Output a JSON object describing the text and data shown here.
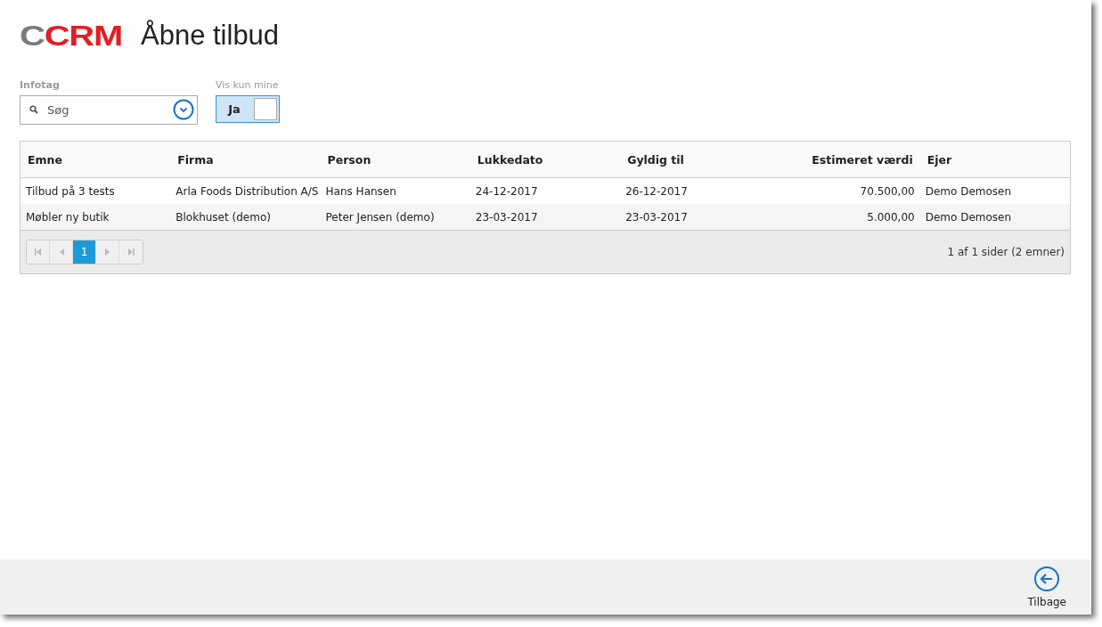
{
  "header": {
    "logo_prefix": "C",
    "logo_main": "CRM",
    "title": "Åbne tilbud"
  },
  "filters": {
    "infotag": {
      "label": "Infotag",
      "placeholder": "Søg"
    },
    "mine": {
      "label": "Vis kun mine",
      "value": "Ja",
      "on": true
    }
  },
  "table": {
    "columns": [
      {
        "label": "Emne",
        "numeric": false
      },
      {
        "label": "Firma",
        "numeric": false
      },
      {
        "label": "Person",
        "numeric": false
      },
      {
        "label": "Lukkedato",
        "numeric": false
      },
      {
        "label": "Gyldig til",
        "numeric": false
      },
      {
        "label": "Estimeret værdi",
        "numeric": true
      },
      {
        "label": "Ejer",
        "numeric": false
      }
    ],
    "rows": [
      [
        "Tilbud på 3 tests",
        "Arla Foods Distribution A/S",
        "Hans Hansen",
        "24-12-2017",
        "26-12-2017",
        "70.500,00",
        "Demo Demosen"
      ],
      [
        "Møbler ny butik",
        "Blokhuset (demo)",
        "Peter Jensen (demo)",
        "23-03-2017",
        "23-03-2017",
        "5.000,00",
        "Demo Demosen"
      ]
    ],
    "pager": {
      "pages": [
        {
          "label": "1",
          "selected": true
        }
      ],
      "first_disabled": true,
      "last_disabled": true,
      "info": "1 af 1 sider (2 emner)"
    }
  },
  "footer": {
    "back_label": "Tilbage"
  }
}
